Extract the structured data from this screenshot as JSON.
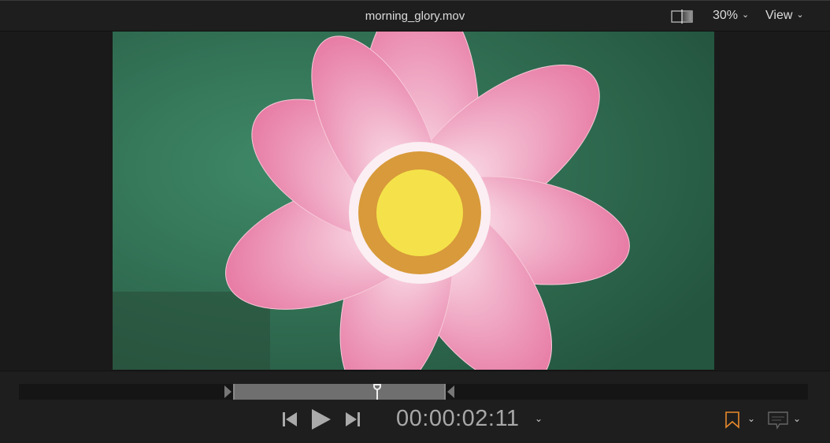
{
  "header": {
    "title": "morning_glory.mov",
    "zoom": "30%",
    "view_label": "View"
  },
  "transport": {
    "timecode": "00:00:02:11",
    "playhead_fraction": 0.34
  },
  "colors": {
    "marker": "#e98a2b",
    "background": "#1e1e1e"
  },
  "icons": [
    "compare-icon",
    "skip-start-icon",
    "play-icon",
    "skip-end-icon",
    "bookmark-icon",
    "caption-icon"
  ]
}
